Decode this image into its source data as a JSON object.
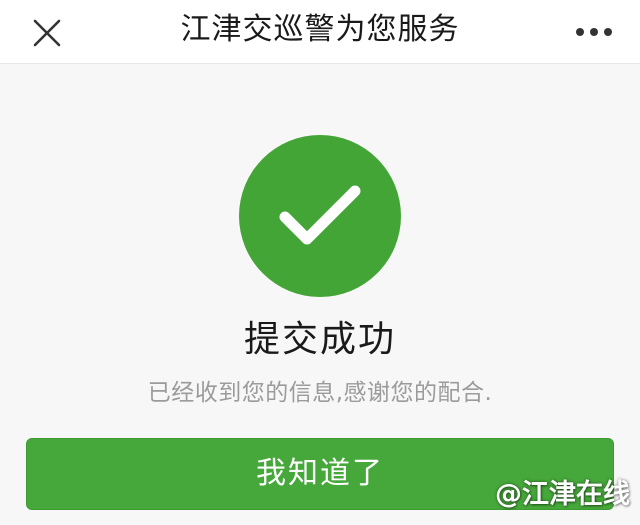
{
  "nav": {
    "title": "江津交巡警为您服务",
    "close_icon": "close-icon",
    "more_icon": "more-dots-icon"
  },
  "result": {
    "status_icon": "checkmark-icon",
    "title": "提交成功",
    "description": "已经收到您的信息,感谢您的配合."
  },
  "actions": {
    "confirm_label": "我知道了"
  },
  "watermark": {
    "text": "@江津在线"
  },
  "colors": {
    "accent_green": "#43a535",
    "button_green": "#46a83a",
    "nav_background": "#ffffff",
    "page_background": "#f7f7f7",
    "description_gray": "#9b9b9b"
  }
}
